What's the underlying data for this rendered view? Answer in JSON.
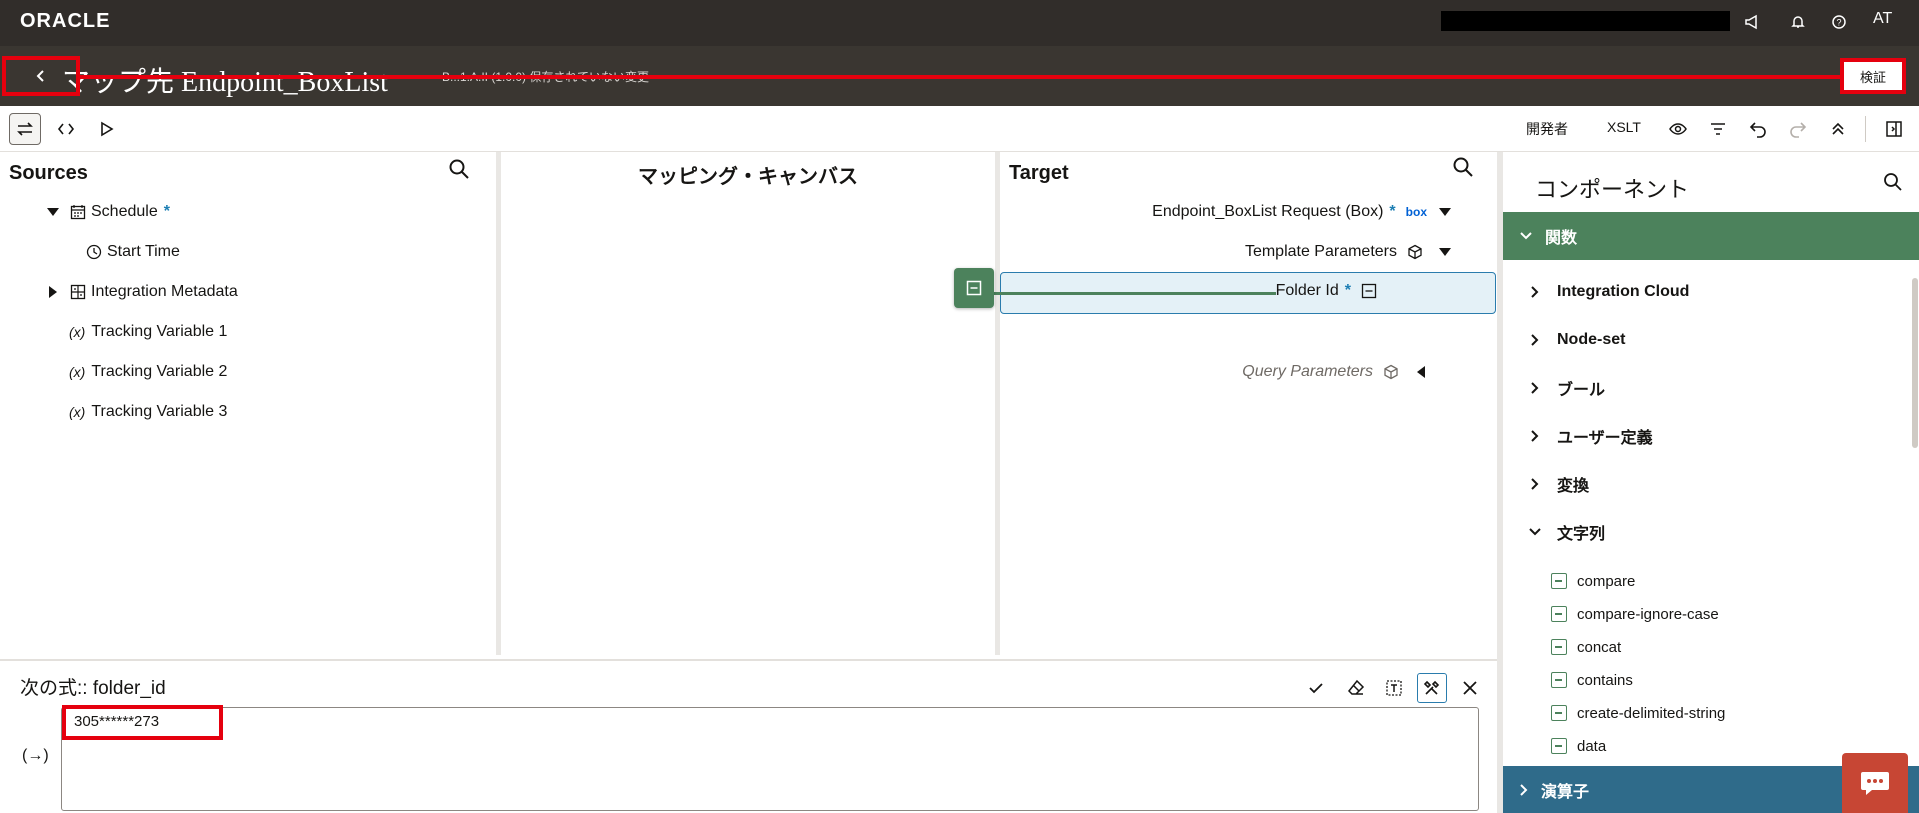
{
  "app": {
    "logo": "ORACLE",
    "user_initials": "AT"
  },
  "header": {
    "title": "マップ先 Endpoint_BoxList",
    "subtitle": "B...1.A.II (1.0.0) 保存されていない変更",
    "validate_label": "検証"
  },
  "toolbar": {
    "developer_label": "開発者",
    "xslt_label": "XSLT"
  },
  "sources": {
    "title": "Sources",
    "items": [
      {
        "label": "Schedule",
        "required": "*"
      },
      {
        "label": "Start Time"
      },
      {
        "label": "Integration Metadata"
      },
      {
        "label": "Tracking Variable 1",
        "prefix": "(x)"
      },
      {
        "label": "Tracking Variable 2",
        "prefix": "(x)"
      },
      {
        "label": "Tracking Variable 3",
        "prefix": "(x)"
      }
    ]
  },
  "canvas": {
    "title": "マッピング・キャンバス"
  },
  "target": {
    "title": "Target",
    "items": [
      {
        "label": "Endpoint_BoxList Request (Box)",
        "required": "*",
        "badge": "box"
      },
      {
        "label": "Template Parameters"
      },
      {
        "label": "Folder Id",
        "required": "*"
      },
      {
        "label": "Query Parameters"
      }
    ]
  },
  "components": {
    "title": "コンポーネント",
    "functions_header": "関数",
    "categories": [
      {
        "label": "Integration Cloud"
      },
      {
        "label": "Node-set"
      },
      {
        "label": "ブール"
      },
      {
        "label": "ユーザー定義"
      },
      {
        "label": "変換"
      },
      {
        "label": "文字列"
      }
    ],
    "string_functions": [
      {
        "label": "compare"
      },
      {
        "label": "compare-ignore-case"
      },
      {
        "label": "concat"
      },
      {
        "label": "contains"
      },
      {
        "label": "create-delimited-string"
      },
      {
        "label": "data"
      }
    ],
    "operators_header": "演算子"
  },
  "expression": {
    "label": "次の式:: folder_id",
    "arrow": "(→)",
    "value": "305******273"
  }
}
